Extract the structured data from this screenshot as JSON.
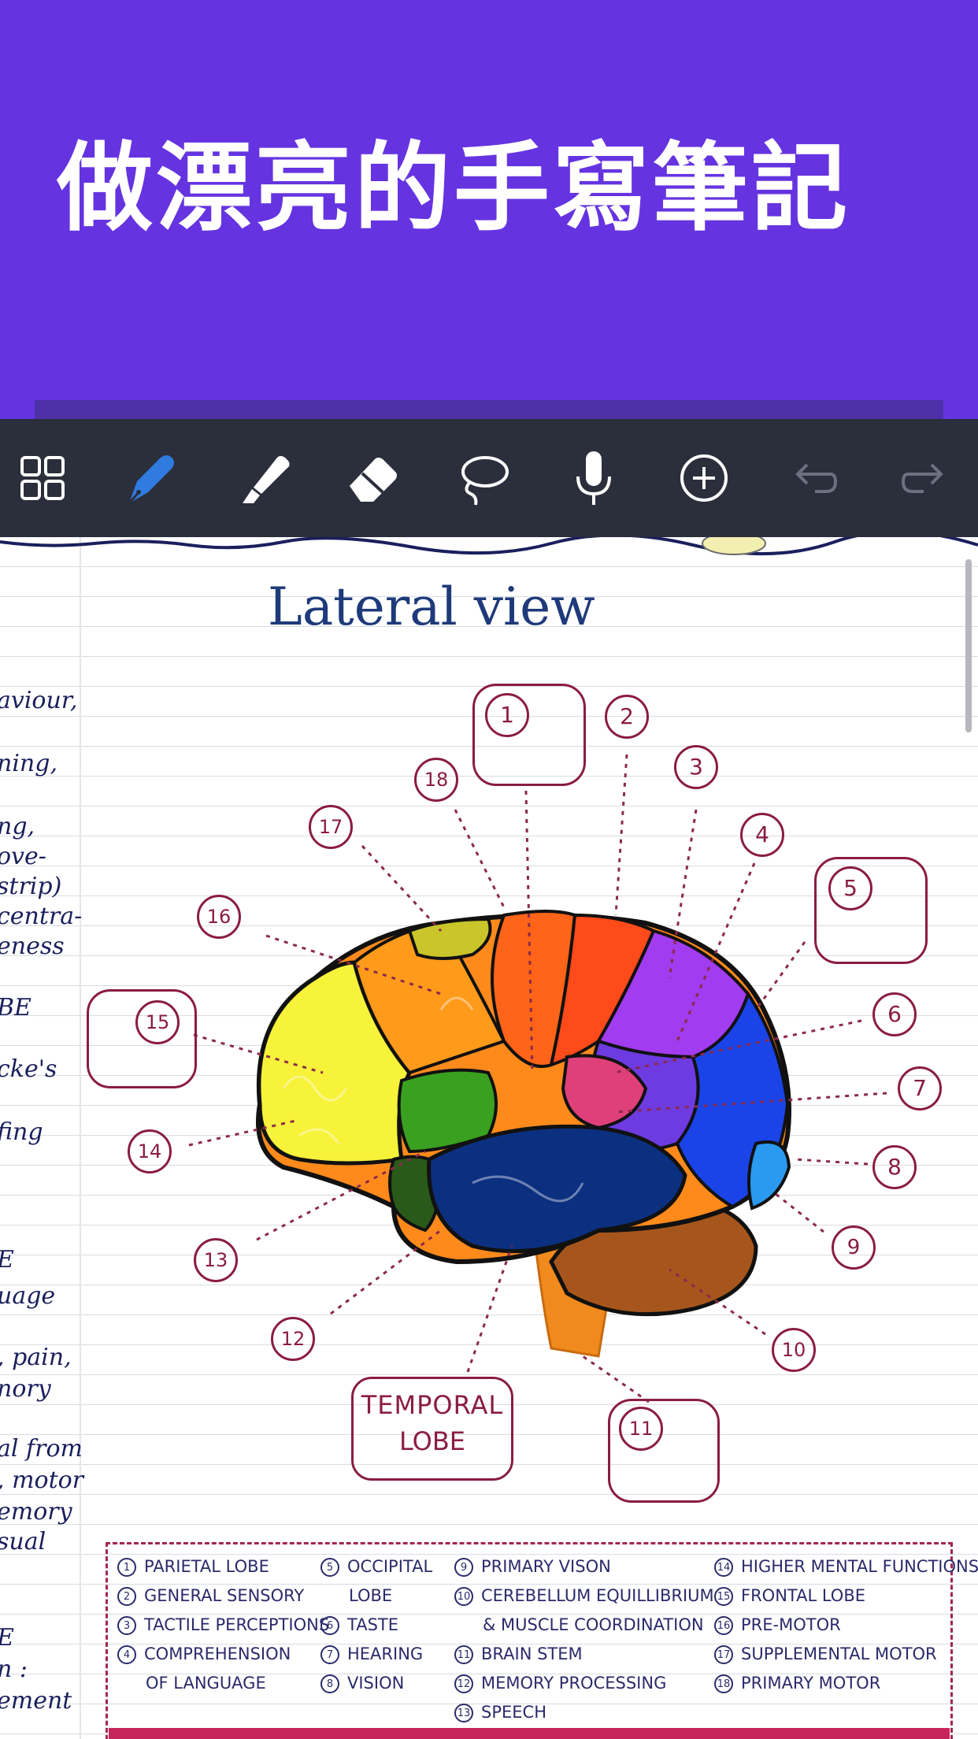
{
  "hero": {
    "title": "做漂亮的手寫筆記"
  },
  "toolbar": {
    "items": [
      {
        "icon": "grid-icon"
      },
      {
        "icon": "pen-icon",
        "active_color": "#2f7be0"
      },
      {
        "icon": "highlighter-icon"
      },
      {
        "icon": "eraser-icon"
      },
      {
        "icon": "lasso-icon"
      },
      {
        "icon": "microphone-icon"
      },
      {
        "icon": "add-icon"
      },
      {
        "icon": "undo-icon"
      },
      {
        "icon": "redo-icon"
      }
    ]
  },
  "note": {
    "diagram_title": "Lateral view",
    "edge_text": [
      "aviour,",
      "ning,",
      "ng,",
      "ove-",
      "strip)",
      "centra-",
      "eness",
      "BE",
      "cke's",
      "fing",
      "E",
      "uage",
      ", pain,",
      "nory",
      "al from",
      ", motor",
      "emory",
      "sual",
      "E",
      "n :",
      "ement"
    ],
    "callouts": [
      "1",
      "2",
      "3",
      "4",
      "5",
      "6",
      "7",
      "8",
      "9",
      "10",
      "11",
      "12",
      "13",
      "14",
      "15",
      "16",
      "17",
      "18"
    ],
    "temporal_label_1": "TEMPORAL",
    "temporal_label_2": "LOBE",
    "legend": {
      "col1": [
        {
          "n": "1",
          "t": "PARIETAL LOBE"
        },
        {
          "n": "2",
          "t": "GENERAL SENSORY"
        },
        {
          "n": "3",
          "t": "TACTILE PERCEPTIONS"
        },
        {
          "n": "4",
          "t": "COMPREHENSION"
        },
        {
          "n": "",
          "t": "OF LANGUAGE"
        }
      ],
      "col2": [
        {
          "n": "5",
          "t": "OCCIPITAL"
        },
        {
          "n": "",
          "t": "LOBE"
        },
        {
          "n": "6",
          "t": "TASTE"
        },
        {
          "n": "7",
          "t": "HEARING"
        },
        {
          "n": "8",
          "t": "VISION"
        }
      ],
      "col3": [
        {
          "n": "9",
          "t": "PRIMARY VISON"
        },
        {
          "n": "10",
          "t": "CEREBELLUM EQUILLIBRIUM"
        },
        {
          "n": "",
          "t": "& MUSCLE COORDINATION"
        },
        {
          "n": "11",
          "t": "BRAIN STEM"
        },
        {
          "n": "12",
          "t": "MEMORY PROCESSING"
        },
        {
          "n": "13",
          "t": "SPEECH"
        }
      ],
      "col4": [
        {
          "n": "14",
          "t": "HIGHER MENTAL FUNCTIONS"
        },
        {
          "n": "15",
          "t": "FRONTAL LOBE"
        },
        {
          "n": "16",
          "t": "PRE-MOTOR"
        },
        {
          "n": "17",
          "t": "SUPPLEMENTAL MOTOR"
        },
        {
          "n": "18",
          "t": "PRIMARY MOTOR"
        }
      ]
    }
  }
}
